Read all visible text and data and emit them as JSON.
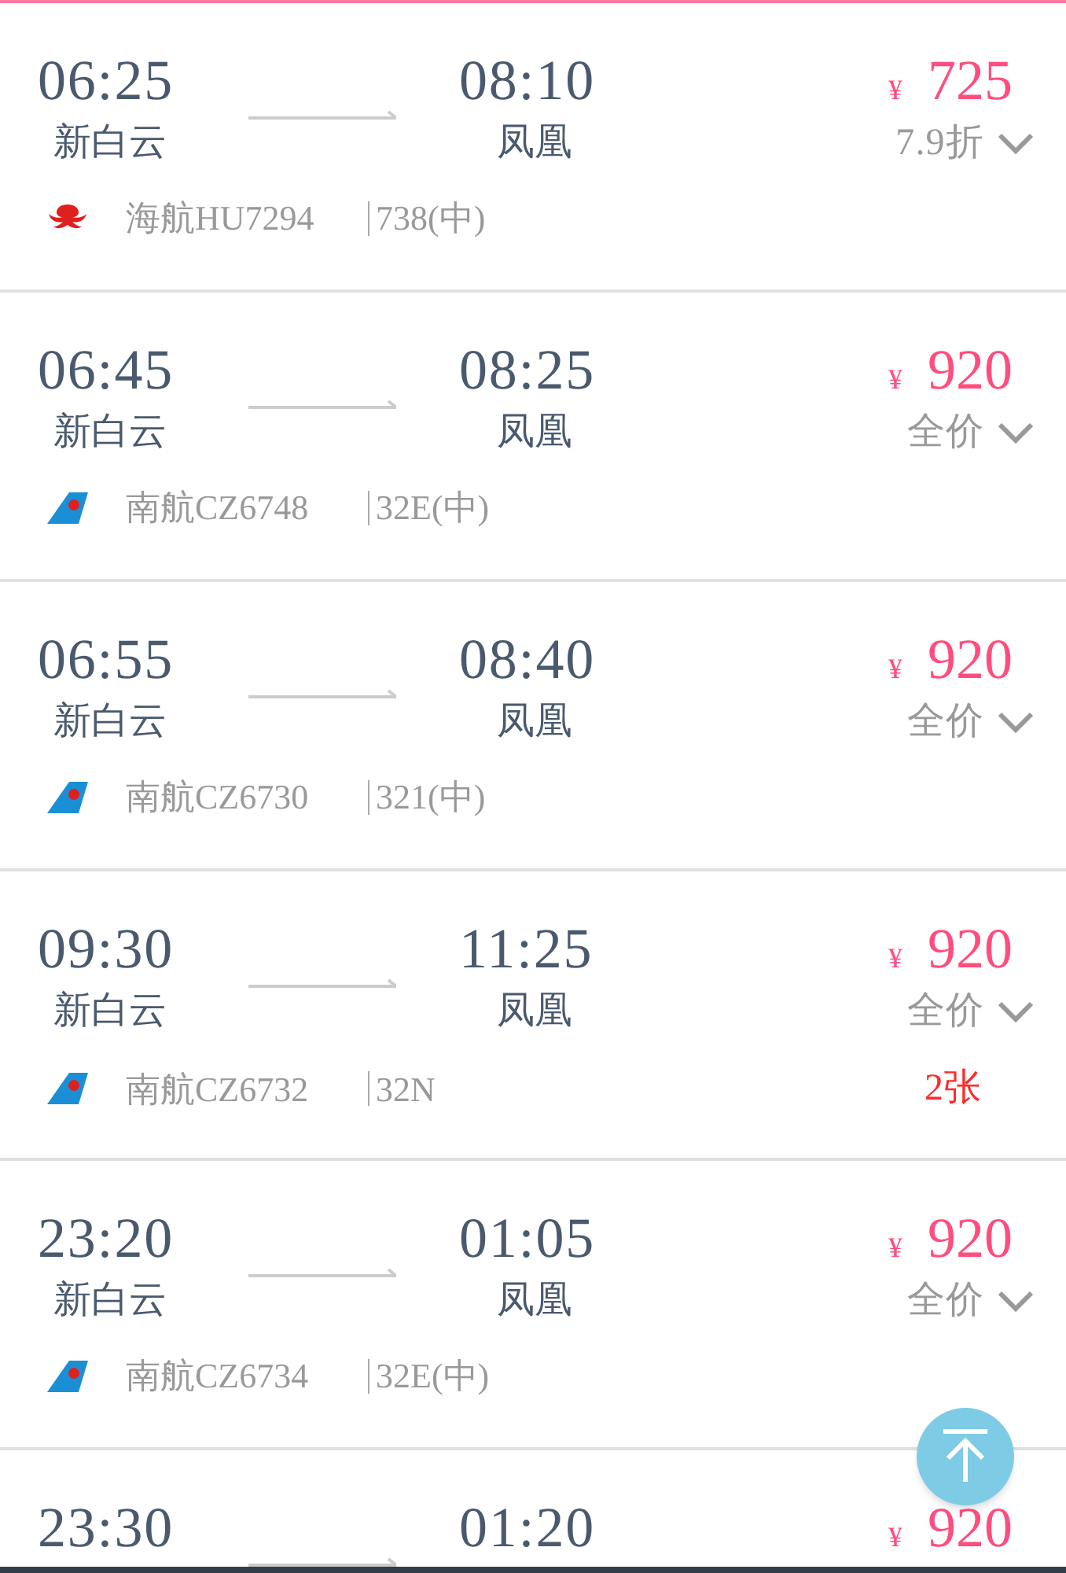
{
  "flights": [
    {
      "depart_time": "06:25",
      "depart_airport": "新白云",
      "arrive_time": "08:10",
      "arrive_airport": "凤凰",
      "currency": "¥",
      "price": "725",
      "fare": "7.9折",
      "kind": "hainan",
      "flight_no": "海航HU7294",
      "aircraft": "738(中)"
    },
    {
      "depart_time": "06:45",
      "depart_airport": "新白云",
      "arrive_time": "08:25",
      "arrive_airport": "凤凰",
      "currency": "¥",
      "price": "920",
      "fare": "全价",
      "kind": "southern",
      "flight_no": "南航CZ6748",
      "aircraft": "32E(中)"
    },
    {
      "depart_time": "06:55",
      "depart_airport": "新白云",
      "arrive_time": "08:40",
      "arrive_airport": "凤凰",
      "currency": "¥",
      "price": "920",
      "fare": "全价",
      "kind": "southern",
      "flight_no": "南航CZ6730",
      "aircraft": "321(中)"
    },
    {
      "depart_time": "09:30",
      "depart_airport": "新白云",
      "arrive_time": "11:25",
      "arrive_airport": "凤凰",
      "currency": "¥",
      "price": "920",
      "fare": "全价",
      "kind": "southern",
      "flight_no": "南航CZ6732",
      "aircraft": "32N",
      "seats_left": "2张"
    },
    {
      "depart_time": "23:20",
      "depart_airport": "新白云",
      "arrive_time": "01:05",
      "arrive_airport": "凤凰",
      "currency": "¥",
      "price": "920",
      "fare": "全价",
      "kind": "southern",
      "flight_no": "南航CZ6734",
      "aircraft": "32E(中)"
    },
    {
      "depart_time": "23:30",
      "arrive_time": "01:20",
      "currency": "¥",
      "price": "920"
    }
  ]
}
